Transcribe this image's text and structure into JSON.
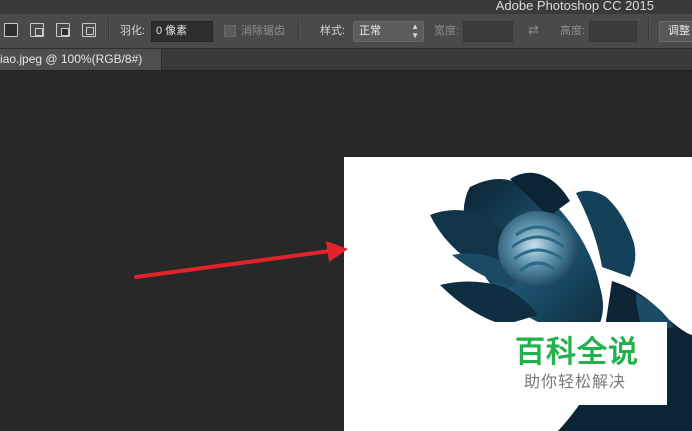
{
  "app": {
    "title": "Adobe Photoshop CC 2015"
  },
  "options_bar": {
    "feather_label": "羽化:",
    "feather_value": "0 像素",
    "antialias_label": "消除锯齿",
    "style_label": "样式:",
    "style_value": "正常",
    "width_label": "宽度:",
    "height_label": "高度:",
    "refine_button": "调整"
  },
  "document": {
    "tab_label": "iao.jpeg @ 100%(RGB/8#)"
  },
  "watermark": {
    "title": "百科全说",
    "subtitle": "助你轻松解决"
  },
  "colors": {
    "annotation_arrow": "#e0242a",
    "watermark_green": "#22b14c",
    "bird_dark": "#0d2434",
    "bird_light": "#9ec4d4"
  },
  "icons": [
    "new-selection-icon",
    "add-to-selection-icon",
    "subtract-from-selection-icon",
    "intersect-selection-icon",
    "swap-dimensions-icon"
  ]
}
